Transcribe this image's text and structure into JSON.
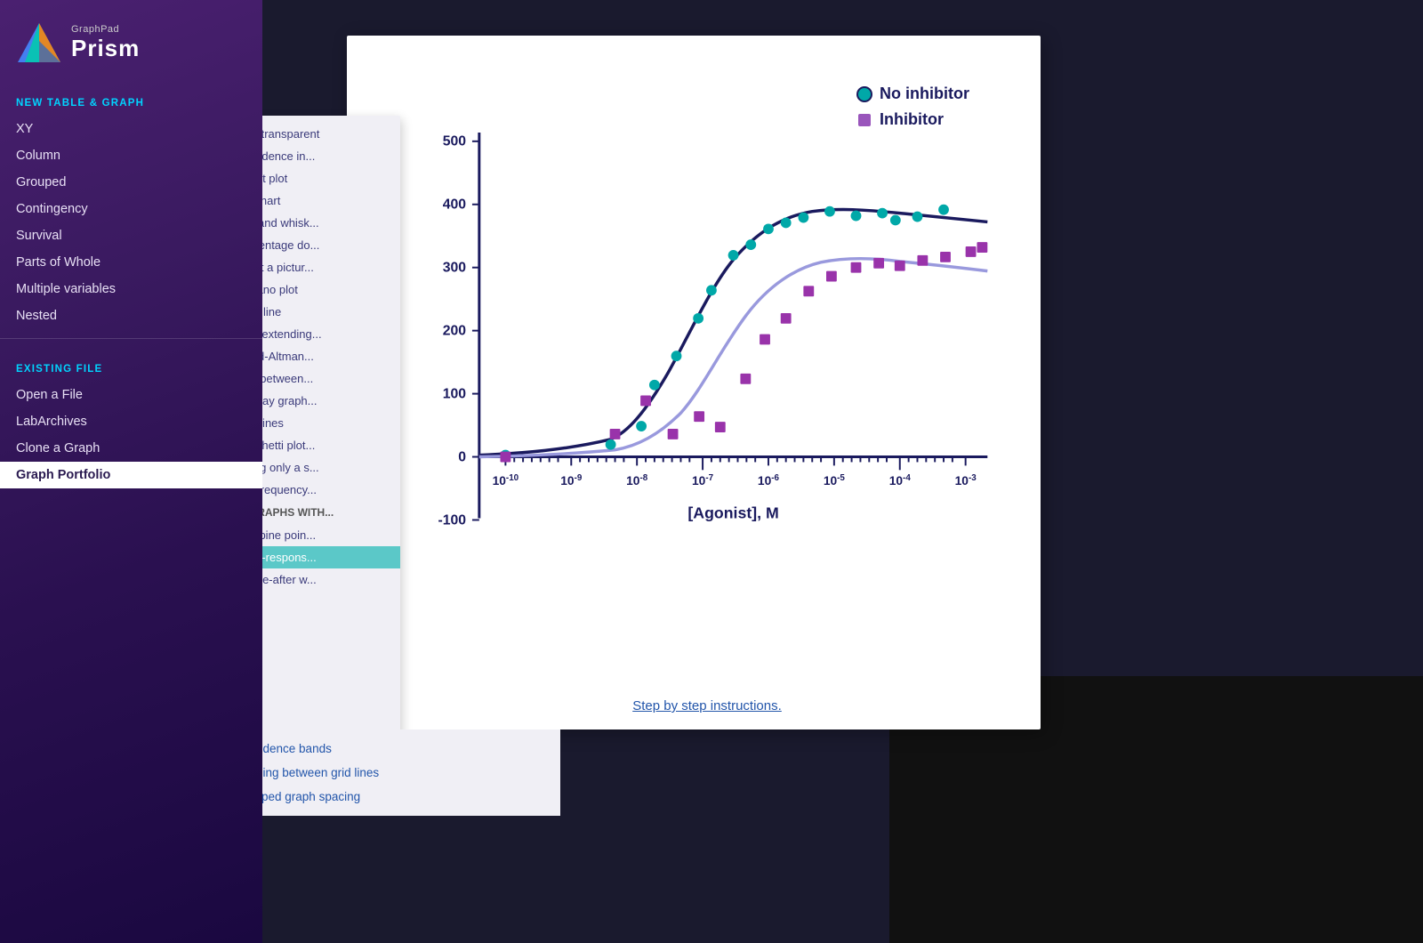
{
  "app": {
    "name": "GraphPad Prism",
    "brand": "GraphPad",
    "logo_text": "Prism"
  },
  "sidebar": {
    "new_table_label": "NEW TABLE & GRAPH",
    "existing_file_label": "EXISTING FILE",
    "items_new": [
      {
        "label": "XY",
        "id": "xy"
      },
      {
        "label": "Column",
        "id": "column"
      },
      {
        "label": "Grouped",
        "id": "grouped"
      },
      {
        "label": "Contingency",
        "id": "contingency"
      },
      {
        "label": "Survival",
        "id": "survival"
      },
      {
        "label": "Parts of Whole",
        "id": "parts-of-whole"
      },
      {
        "label": "Multiple variables",
        "id": "multiple-variables"
      },
      {
        "label": "Nested",
        "id": "nested"
      }
    ],
    "items_existing": [
      {
        "label": "Open a File",
        "id": "open-file"
      },
      {
        "label": "LabArchives",
        "id": "labarchives"
      },
      {
        "label": "Clone a Graph",
        "id": "clone-graph"
      },
      {
        "label": "Graph Portfolio",
        "id": "graph-portfolio",
        "active": true
      }
    ]
  },
  "menu_panel": {
    "items": [
      {
        "label": "Semitransparent",
        "id": "semitransparent"
      },
      {
        "label": "Confidence in...",
        "id": "confidence"
      },
      {
        "label": "Donut plot",
        "id": "donut-plot"
      },
      {
        "label": "Pie chart",
        "id": "pie-chart"
      },
      {
        "label": "Box and whisk...",
        "id": "box-whisker"
      },
      {
        "label": "Percentage do...",
        "id": "percentage-dot"
      },
      {
        "label": "Insert a pictur...",
        "id": "insert-picture"
      },
      {
        "label": "Volcano plot",
        "id": "volcano-plot"
      },
      {
        "label": "Time line",
        "id": "time-line"
      },
      {
        "label": "Bars extending...",
        "id": "bars-extending"
      },
      {
        "label": "Bland-Altman...",
        "id": "bland-altman"
      },
      {
        "label": "Line between...",
        "id": "line-between"
      },
      {
        "label": "Overlay graph...",
        "id": "overlay-graph"
      },
      {
        "label": "Grid lines",
        "id": "grid-lines"
      },
      {
        "label": "Spaghetti plot...",
        "id": "spaghetti-plot"
      },
      {
        "label": "Fitting only a s...",
        "id": "fitting-only"
      },
      {
        "label": "XY Frequency...",
        "id": "xy-frequency"
      }
    ],
    "section_graphs_with": "GRAPHS WITH...",
    "graphs_with_items": [
      {
        "label": "Combine poin...",
        "id": "combine-points"
      },
      {
        "label": "Dose-respons...",
        "id": "dose-response",
        "selected": true
      },
      {
        "label": "Before-after w...",
        "id": "before-after"
      }
    ]
  },
  "bottom_menu": {
    "items": [
      {
        "label": "Confidence bands",
        "id": "confidence-bands"
      },
      {
        "label": "Shading between grid lines",
        "id": "shading-grid"
      },
      {
        "label": "Grouped graph spacing",
        "id": "grouped-spacing"
      }
    ]
  },
  "graph": {
    "legend": [
      {
        "label": "No inhibitor",
        "color": "#00a8a8",
        "shape": "circle"
      },
      {
        "label": "Inhibitor",
        "color": "#9955bb",
        "shape": "square"
      }
    ],
    "y_axis": {
      "max": 500,
      "ticks": [
        500,
        400,
        300,
        200,
        100,
        0,
        -100
      ]
    },
    "x_axis": {
      "label": "[Agonist], M",
      "ticks": [
        "10⁻¹⁰",
        "10⁻⁹",
        "10⁻⁸",
        "10⁻⁷",
        "10⁻⁶",
        "10⁻⁵",
        "10⁻⁴",
        "10⁻³"
      ]
    },
    "step_link": "Step by step instructions."
  },
  "colors": {
    "sidebar_bg_top": "#4a2070",
    "sidebar_bg_bottom": "#1a0840",
    "accent_cyan": "#00d4ff",
    "teal": "#00a8a8",
    "purple": "#9955bb",
    "dark_navy": "#1a1a5e",
    "menu_bg": "#f0eff5",
    "selected_teal": "#5bc8c8"
  }
}
